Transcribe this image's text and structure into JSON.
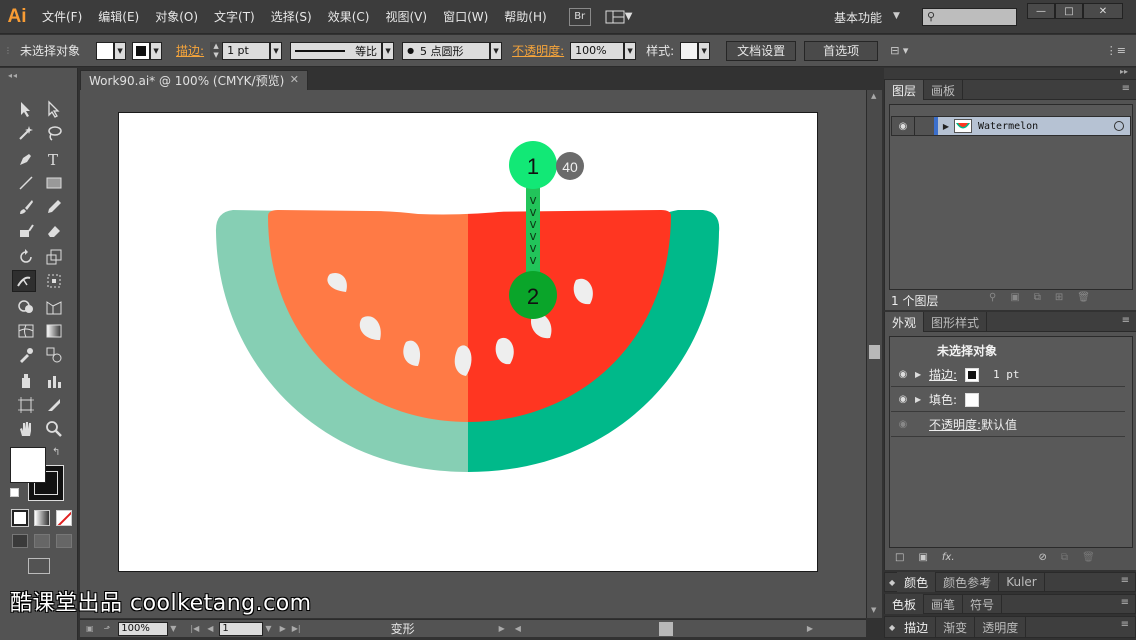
{
  "app": {
    "logo": "Ai"
  },
  "menu": [
    "文件(F)",
    "编辑(E)",
    "对象(O)",
    "文字(T)",
    "选择(S)",
    "效果(C)",
    "视图(V)",
    "窗口(W)",
    "帮助(H)"
  ],
  "menubar": {
    "bridge_label": "Br",
    "workspace": "基本功能",
    "search_placeholder": ""
  },
  "window_controls": {
    "minimize": "—",
    "maximize": "□",
    "close": "✕"
  },
  "control": {
    "selection": "未选择对象",
    "stroke_label": "描边:",
    "stroke_weight": "1 pt",
    "stroke_profile": "等比",
    "brush": "5 点圆形",
    "opacity_label": "不透明度:",
    "opacity": "100%",
    "style_label": "样式:",
    "doc_setup": "文档设置",
    "prefs": "首选项"
  },
  "document": {
    "tab_title": "Work90.ai* @ 100% (CMYK/预览)"
  },
  "artwork": {
    "colors": {
      "rind_light": "#86cfb4",
      "rind_dark": "#00b98a",
      "flesh_light": "#ff7a45",
      "flesh_dark": "#ff3621",
      "seed": "#eeeeee",
      "handle_1": "#12e876",
      "handle_2": "#0aa52a"
    },
    "handle_1_label": "1",
    "handle_2_label": "2",
    "step_count": "40",
    "step_marker": "v"
  },
  "status_bar": {
    "zoom": "100%",
    "page": "1",
    "status": "变形"
  },
  "layers_panel": {
    "tabs": [
      "图层",
      "画板"
    ],
    "layer_name": "Watermelon",
    "layer_count": "1 个图层"
  },
  "appearance_panel": {
    "tabs": [
      "外观",
      "图形样式"
    ],
    "title": "未选择对象",
    "stroke_label": "描边:",
    "stroke_value": "1 pt",
    "fill_label": "填色:",
    "opacity_label": "不透明度:",
    "opacity_value": "默认值",
    "fx_label": "fx."
  },
  "collapsed_panels": [
    [
      "颜色",
      "颜色参考",
      "Kuler"
    ],
    [
      "色板",
      "画笔",
      "符号"
    ],
    [
      "描边",
      "渐变",
      "透明度"
    ]
  ],
  "watermark": "酷课堂出品 coolketang.com"
}
